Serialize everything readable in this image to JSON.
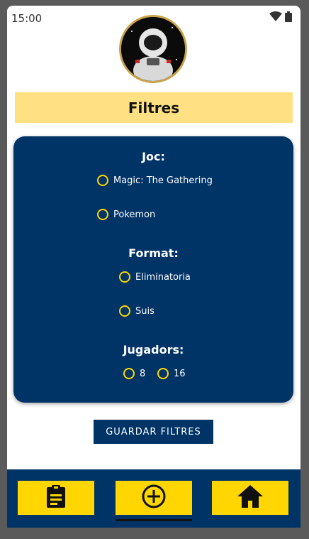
{
  "status": {
    "time": "15:00"
  },
  "header": {
    "title": "Filtres"
  },
  "filters": {
    "game": {
      "title": "Joc:",
      "options": [
        "Magic: The Gathering",
        "Pokemon"
      ]
    },
    "format": {
      "title": "Format:",
      "options": [
        "Eliminatoria",
        "Suis"
      ]
    },
    "players": {
      "title": "Jugadors:",
      "options": [
        "8",
        "16"
      ]
    }
  },
  "actions": {
    "save_label": "GUARDAR FILTRES"
  },
  "nav": {
    "items": [
      {
        "icon": "clipboard-icon"
      },
      {
        "icon": "add-circle-icon",
        "selected": true
      },
      {
        "icon": "home-icon"
      }
    ]
  },
  "colors": {
    "primary": "#003366",
    "accent": "#ffd600",
    "title_bg": "#ffe082"
  }
}
